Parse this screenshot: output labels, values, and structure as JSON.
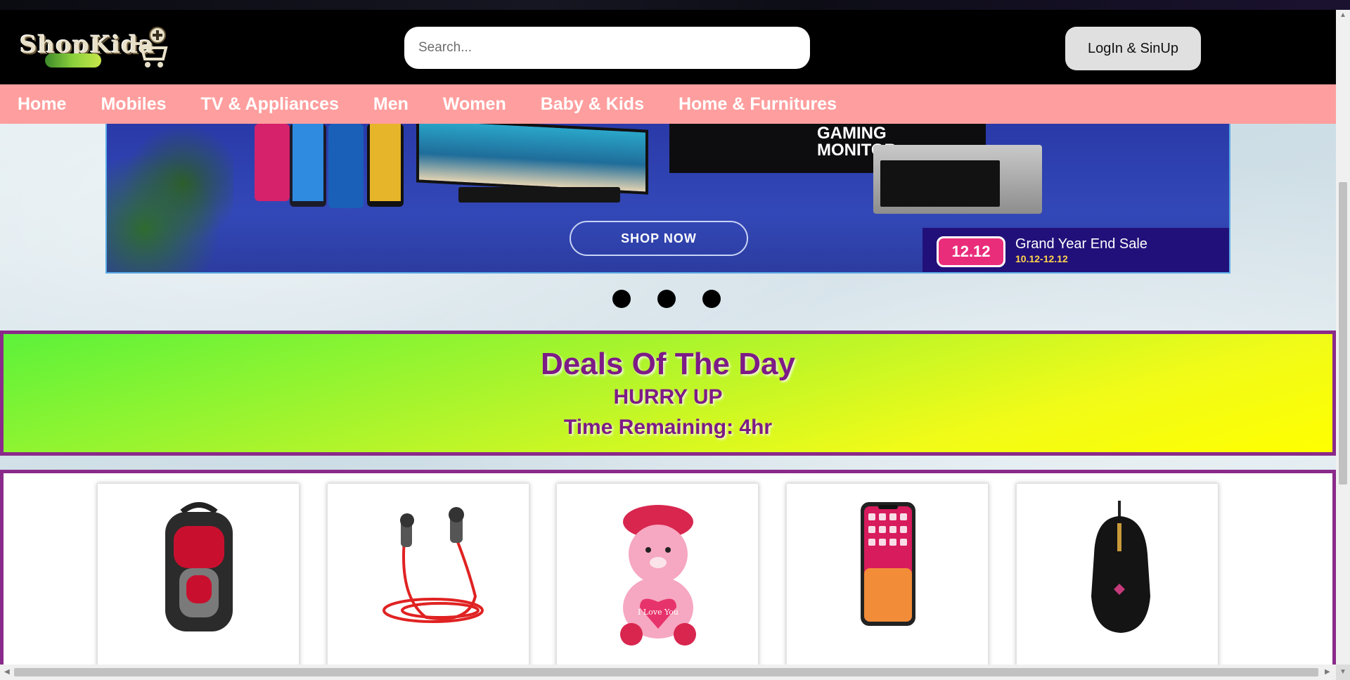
{
  "header": {
    "logo_text": "ShopKida",
    "search_placeholder": "Search...",
    "login_label": "LogIn & SinUp"
  },
  "nav": {
    "items": [
      "Home",
      "Mobiles",
      "TV & Appliances",
      "Men",
      "Women",
      "Baby & Kids",
      "Home & Furnitures"
    ]
  },
  "banner": {
    "monitor_text": "GAMING MONITOR",
    "shop_now": "SHOP NOW",
    "sale_badge": "12.12",
    "sale_title": "Grand Year End Sale",
    "sale_dates": "10.12-12.12",
    "slide_count": 3
  },
  "deals": {
    "title": "Deals Of The Day",
    "subtitle": "HURRY UP",
    "timer": "Time Remaining: 4hr"
  },
  "products": {
    "items": [
      {
        "icon": "backpack-icon"
      },
      {
        "icon": "earphones-icon"
      },
      {
        "icon": "teddy-bear-icon",
        "tag": "I Love You"
      },
      {
        "icon": "smartphone-icon"
      },
      {
        "icon": "gaming-mouse-icon"
      }
    ]
  },
  "colors": {
    "header_bg": "#000000",
    "nav_bg": "#ff9e9e",
    "deals_border": "#8a2a8a",
    "deals_text": "#7d1b86"
  }
}
